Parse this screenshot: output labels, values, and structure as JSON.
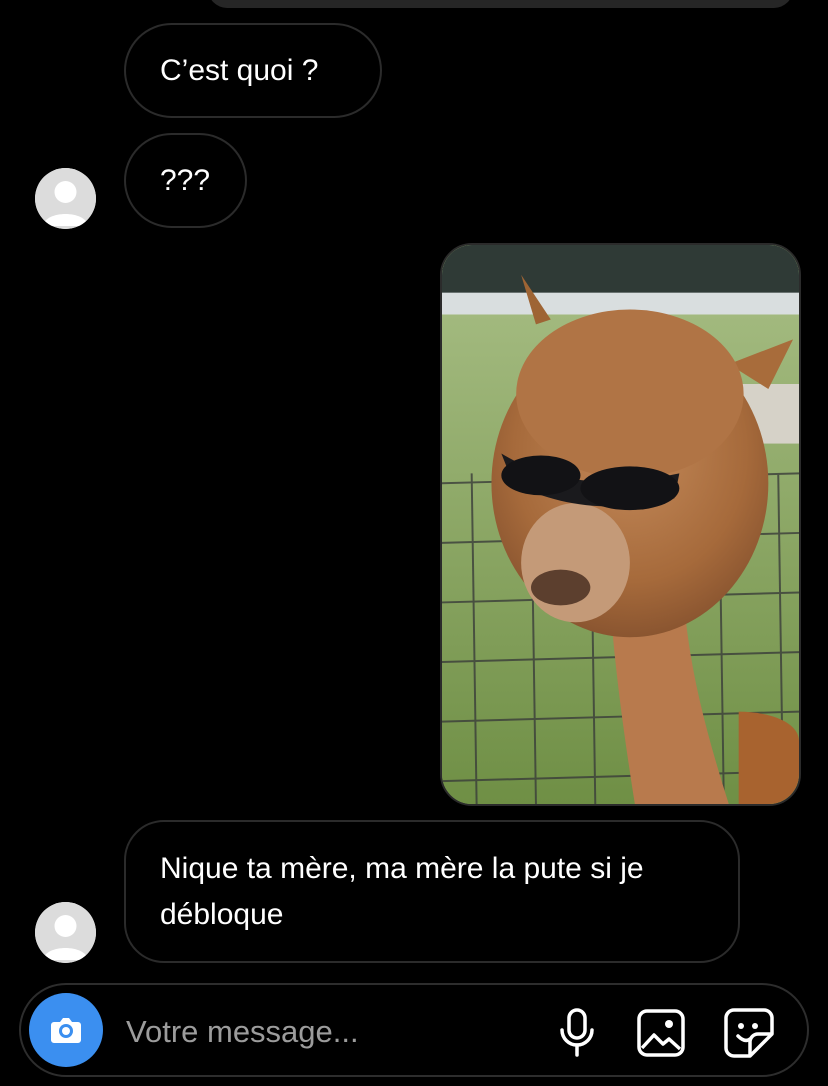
{
  "messages": [
    {
      "text": "C’est quoi ?"
    },
    {
      "text": "???"
    },
    {
      "text": "Nique ta mère, ma mère la pute si je débloque"
    }
  ],
  "composer": {
    "placeholder": "Votre message..."
  },
  "icons": {
    "camera": "camera-icon",
    "mic": "microphone-icon",
    "gallery": "image-gallery-icon",
    "sticker": "sticker-icon"
  },
  "colors": {
    "background": "#000000",
    "bubble_border": "#2b2b2b",
    "accent": "#3b8ff0",
    "placeholder": "#9c9c9c"
  }
}
